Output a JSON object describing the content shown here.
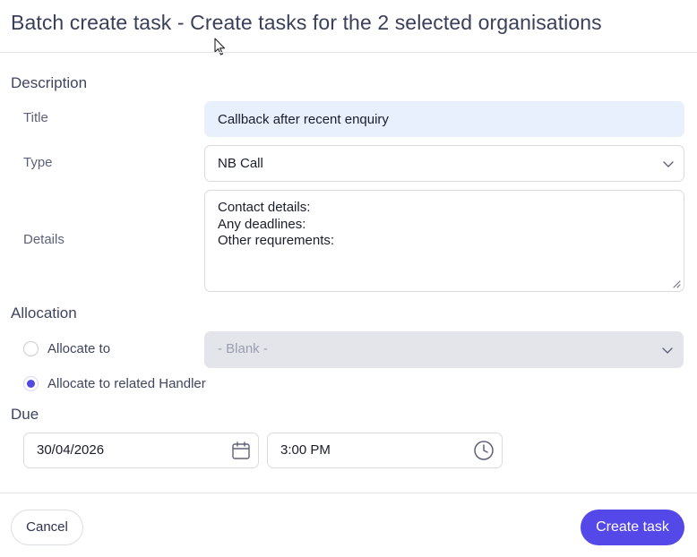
{
  "dialog": {
    "title": "Batch create task - Create tasks for the 2 selected organisations"
  },
  "description": {
    "heading": "Description",
    "title_label": "Title",
    "title_value": "Callback after recent enquiry",
    "type_label": "Type",
    "type_value": "NB Call",
    "details_label": "Details",
    "details_lines": [
      "Contact details:",
      "Any deadlines:",
      "Other requrements:"
    ]
  },
  "allocation": {
    "heading": "Allocation",
    "allocate_to_label": "Allocate to",
    "allocate_to_value": "- Blank -",
    "allocate_related_label": "Allocate to related Handler",
    "selected_option": "Allocate to related Handler"
  },
  "due": {
    "heading": "Due",
    "date_value": "30/04/2026",
    "time_value": "3:00 PM",
    "date_icon": "calendar-icon",
    "time_icon": "clock-icon"
  },
  "footer": {
    "cancel_label": "Cancel",
    "create_label": "Create task"
  },
  "colors": {
    "accent": "#5449e8",
    "title_field_bg": "#e8f0fd",
    "disabled_bg": "#e4e5ea"
  }
}
